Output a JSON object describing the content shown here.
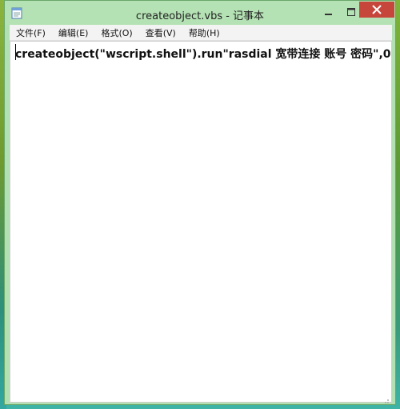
{
  "window": {
    "title": "createobject.vbs - 记事本"
  },
  "icons": {
    "app": "notepad-icon",
    "minimize": "minimize-icon",
    "maximize": "maximize-icon",
    "close": "close-icon"
  },
  "menu": {
    "items": [
      {
        "label": "文件(F)"
      },
      {
        "label": "编辑(E)"
      },
      {
        "label": "格式(O)"
      },
      {
        "label": "查看(V)"
      },
      {
        "label": "帮助(H)"
      }
    ]
  },
  "editor": {
    "content": "createobject(\"wscript.shell\").run\"rasdial 宽带连接 账号 密码\",0"
  },
  "colors": {
    "titlebar": "#b4e2b4",
    "close_button": "#c7463b",
    "editor_bg": "#ffffff"
  }
}
